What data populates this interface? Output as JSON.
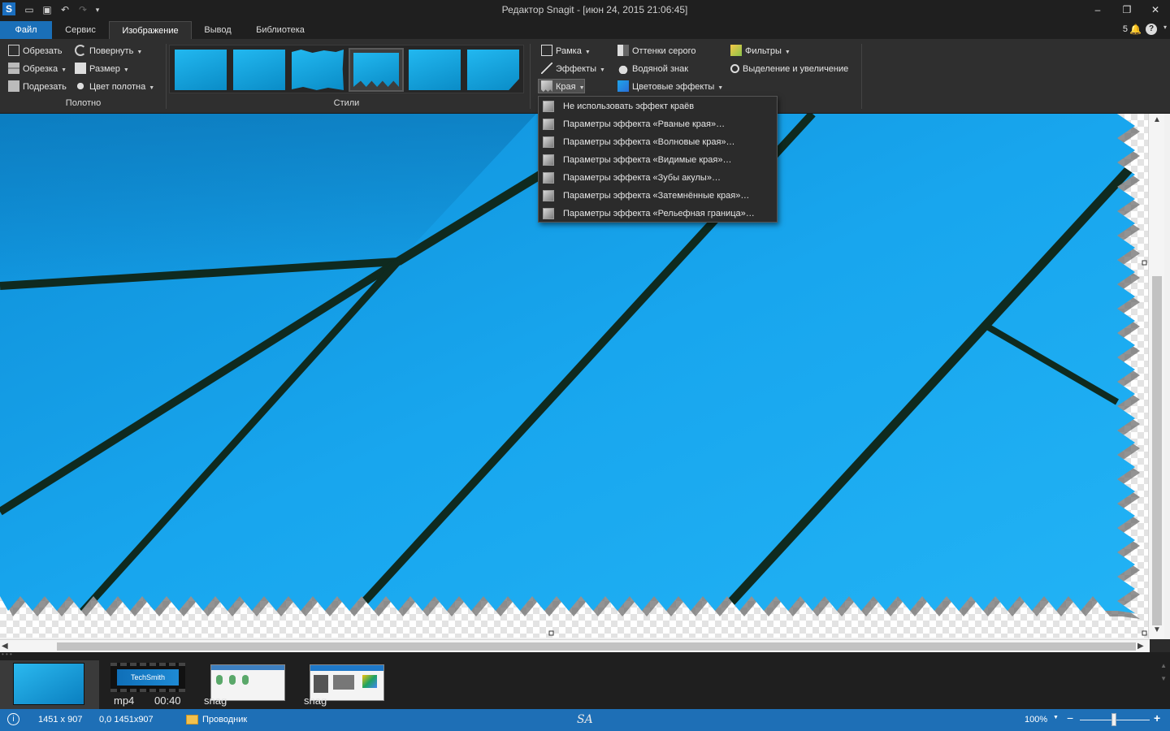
{
  "window": {
    "logo": "S",
    "title": "Редактор Snagit - [июн 24, 2015 21:06:45]",
    "minimize": "–",
    "restore": "❐",
    "close": "✕"
  },
  "tabs": {
    "file": "Файл",
    "service": "Сервис",
    "image": "Изображение",
    "output": "Вывод",
    "library": "Библиотека"
  },
  "notifications": {
    "count": "5"
  },
  "ribbon": {
    "canvas_group": {
      "crop": "Обрезать",
      "rotate": "Повернуть",
      "cutout": "Обрезка",
      "resize": "Размер",
      "trim": "Подрезать",
      "canvas_color": "Цвет полотна",
      "label": "Полотно"
    },
    "styles_group": {
      "label": "Стили"
    },
    "effects_group": {
      "border": "Рамка",
      "effects": "Эффекты",
      "edges": "Края",
      "grayscale": "Оттенки серого",
      "watermark": "Водяной знак",
      "color_effects": "Цветовые эффекты",
      "filters": "Фильтры",
      "spotlight_magnify": "Выделение и увеличение"
    }
  },
  "edges_menu": {
    "items": [
      "Не использовать эффект краёв",
      "Параметры эффекта «Рваные края»…",
      "Параметры эффекта «Волновые края»…",
      "Параметры эффекта «Видимые края»…",
      "Параметры эффекта «Зубы акулы»…",
      "Параметры эффекта «Затемнённые края»…",
      "Параметры эффекта «Рельефная граница»…"
    ]
  },
  "tray": {
    "item2": {
      "brand": "TechSmith",
      "type": "mp4",
      "duration": "00:40"
    },
    "item3": {
      "type": "snag"
    },
    "item4": {
      "type": "snag"
    }
  },
  "status": {
    "info_icon": "i",
    "image_size": "1451 x 907",
    "position": "0,0  1451x907",
    "explorer": "Проводник",
    "signature": "SA",
    "zoom": "100%"
  },
  "colors": {
    "accent": "#1e6fb6",
    "sky_blue": "#129fe8",
    "line_dark": "#0f2a1f"
  }
}
